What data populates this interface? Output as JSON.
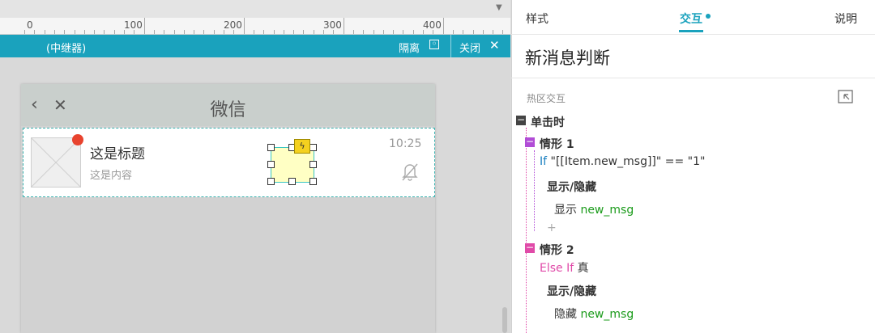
{
  "ruler": {
    "labels": [
      "0",
      "100",
      "200",
      "300",
      "400"
    ]
  },
  "editbar": {
    "label": "(中继器)",
    "isolate": "隔离",
    "close": "关闭"
  },
  "phone": {
    "nav_title": "微信",
    "item_title": "这是标题",
    "item_content": "这是内容",
    "item_time": "10:25"
  },
  "panel": {
    "tabs": [
      "样式",
      "交互",
      "说明"
    ],
    "title": "新消息判断",
    "section": "热区交互",
    "event": "单击时",
    "case1": {
      "name": "情形 1",
      "cond_kw": "If",
      "cond": " \"[[Item.new_msg]]\" == \"1\"",
      "action": "显示/隐藏",
      "detail_verb": "显示",
      "detail_target": " new_msg"
    },
    "add": "+",
    "case2": {
      "name": "情形 2",
      "cond_kw": "Else If",
      "cond": " 真",
      "action": "显示/隐藏",
      "detail_verb": "隐藏",
      "detail_target": " new_msg"
    }
  },
  "colors": {
    "accent": "#1aa2bd",
    "case_pink": "#e04aa8",
    "target_green": "#1a9b1a",
    "badge_red": "#e8432e"
  }
}
